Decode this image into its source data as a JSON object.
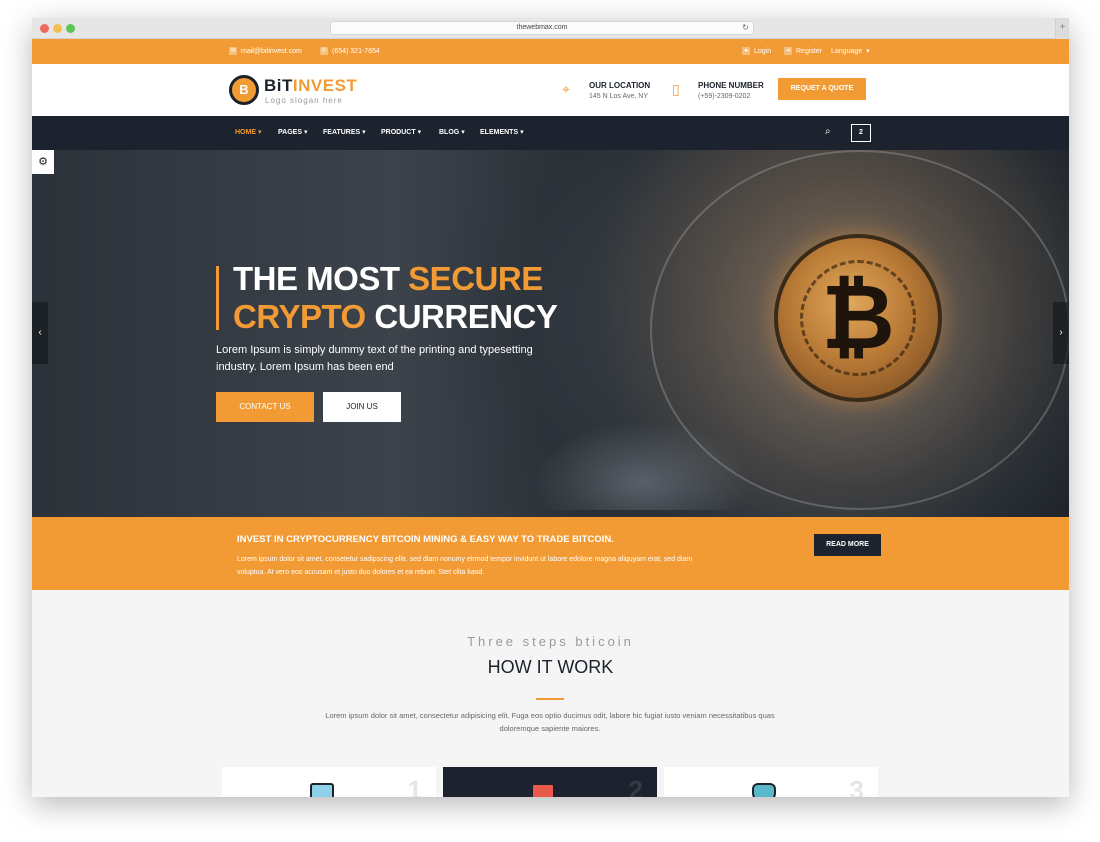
{
  "browser": {
    "url": "thewebmax.com"
  },
  "topbar": {
    "email": "mail@bitinvest.com",
    "phone": "(654) 321-7654",
    "login": "Login",
    "register": "Register",
    "language": "Language"
  },
  "header": {
    "logo_b": "B",
    "logo_dark": "BiT",
    "logo_orange": "INVEST",
    "slogan": "Logo slogan here",
    "location_title": "OUR LOCATION",
    "location_value": "145 N Los Ave, NY",
    "phone_title": "PHONE NUMBER",
    "phone_value": "(+59)-2309-0202",
    "quote_button": "REQUET A QUOTE"
  },
  "nav": {
    "items": [
      "HOME",
      "PAGES",
      "FEATURES",
      "PRODUCT",
      "BLOG",
      "ELEMENTS"
    ],
    "cart_count": "2"
  },
  "hero": {
    "line1_white": "THE MOST ",
    "line1_orange": "SECURE",
    "line2_orange": "CRYPTO",
    "line2_white": " CURRENCY",
    "description": "Lorem Ipsum is simply dummy text of the printing and typesetting industry. Lorem Ipsum has been end",
    "contact_button": "CONTACT US",
    "join_button": "JOIN US"
  },
  "band": {
    "title": "INVEST IN CRYPTOCURRENCY BITCOIN MINING & EASY WAY TO TRADE BITCOIN.",
    "text": "Lorem ipsum dolor sit amet, consetetur sadipscing elitr, sed diam nonumy eirmod tempor invidunt ut labore edolore magna aliquyam erat, sed diam voluptua. At vero eos accusam et justo duo dolores et ea rebum. Stet clita kasd.",
    "read_more": "READ MORE"
  },
  "how": {
    "subtitle": "Three steps bticoin",
    "title": "HOW IT WORK",
    "description": "Lorem ipsum dolor sit amet, consectetur adipisicing elit. Fuga eos optio ducimus odit, labore hic fugiat iusto veniam necessitatibus quas doloremque sapiente maiores.",
    "steps": [
      "1",
      "2",
      "3"
    ]
  },
  "colors": {
    "accent": "#f29b35",
    "dark": "#1d232e"
  },
  "icons": [
    "email-icon",
    "phone-icon",
    "user-icon",
    "register-icon",
    "location-icon",
    "mobile-icon",
    "search-icon",
    "cart-icon",
    "gear-icon",
    "chevron-left-icon",
    "chevron-right-icon"
  ]
}
